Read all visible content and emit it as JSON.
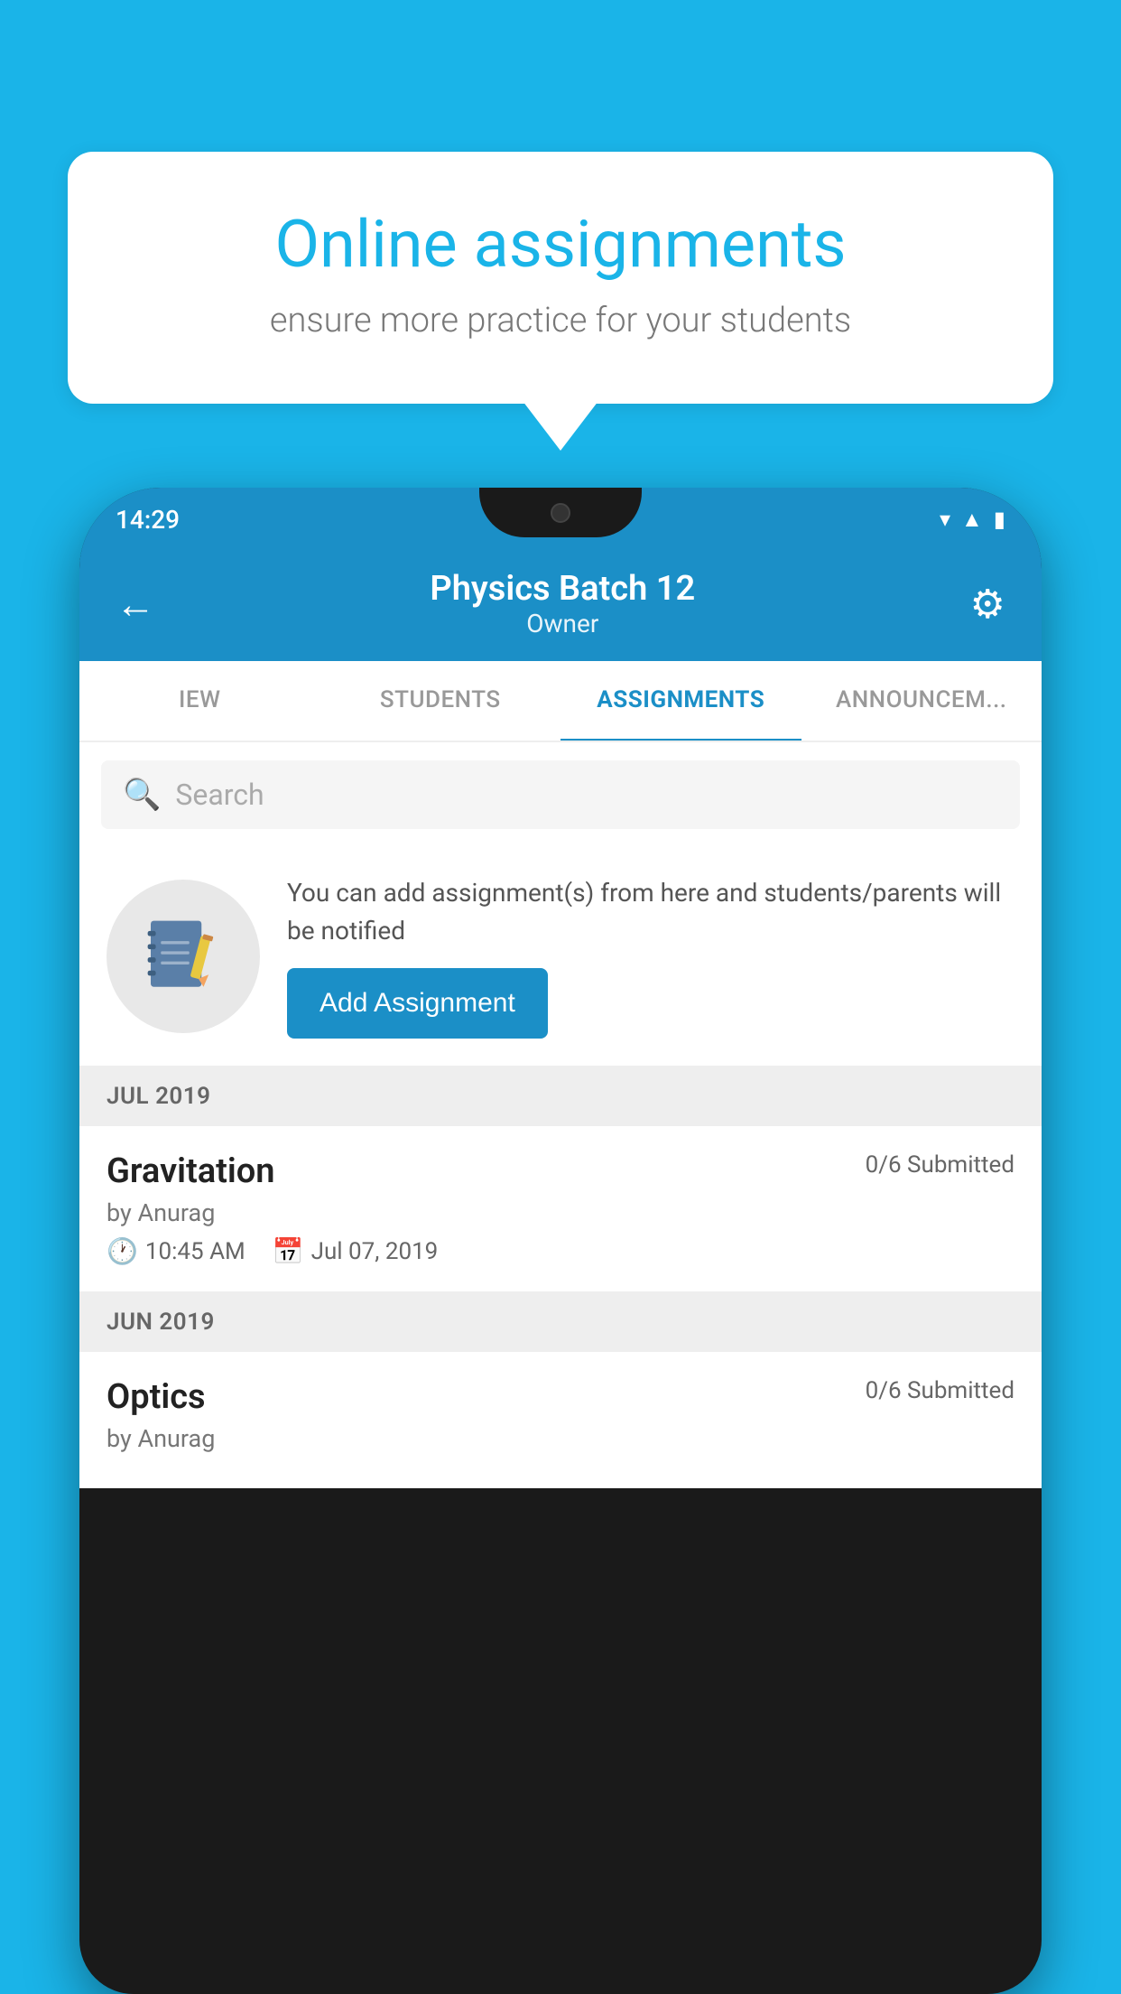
{
  "background_color": "#1ab4e8",
  "speech_bubble": {
    "title": "Online assignments",
    "subtitle": "ensure more practice for your students"
  },
  "phone": {
    "status_bar": {
      "time": "14:29",
      "icons": [
        "wifi",
        "signal",
        "battery"
      ]
    },
    "header": {
      "title": "Physics Batch 12",
      "subtitle": "Owner",
      "back_label": "←",
      "settings_label": "⚙"
    },
    "tabs": [
      {
        "label": "IEW",
        "active": false
      },
      {
        "label": "STUDENTS",
        "active": false
      },
      {
        "label": "ASSIGNMENTS",
        "active": true
      },
      {
        "label": "ANNOUNCEM...",
        "active": false
      }
    ],
    "search": {
      "placeholder": "Search"
    },
    "info_card": {
      "text": "You can add assignment(s) from here and students/parents will be notified",
      "button_label": "Add Assignment"
    },
    "sections": [
      {
        "month": "JUL 2019",
        "assignments": [
          {
            "name": "Gravitation",
            "submitted": "0/6 Submitted",
            "by": "by Anurag",
            "time": "10:45 AM",
            "date": "Jul 07, 2019"
          }
        ]
      },
      {
        "month": "JUN 2019",
        "assignments": [
          {
            "name": "Optics",
            "submitted": "0/6 Submitted",
            "by": "by Anurag",
            "time": "",
            "date": ""
          }
        ]
      }
    ]
  }
}
